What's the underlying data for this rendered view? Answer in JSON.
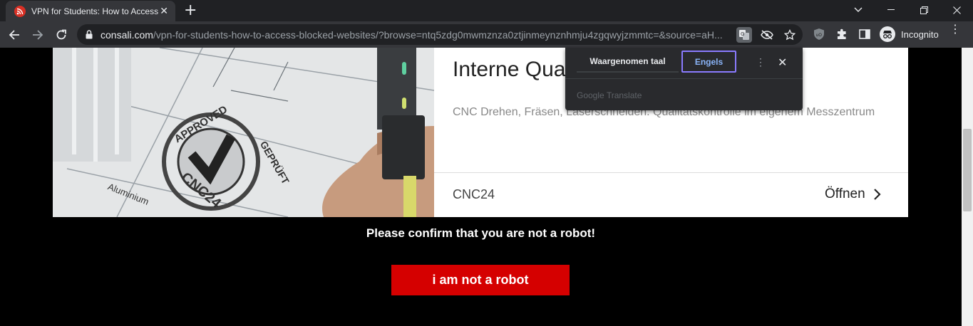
{
  "browser": {
    "tab_title": "VPN for Students: How to Access Blocked Websites",
    "tab_close": "✕",
    "new_tab": "+",
    "url_host": "consali.com",
    "url_path": "/vpn-for-students-how-to-access-blocked-websites/?browse=ntq5zdg0mwmznza0ztjinmeynznhmju4zgqwyjzmmtc=&source=aH...",
    "profile_label": "Incognito"
  },
  "translate_popup": {
    "detected_language": "Waargenomen taal",
    "target_language": "Engels",
    "brand_google": "Google",
    "brand_translate": "Translate"
  },
  "card": {
    "title": "Interne Qualitätskontrolle",
    "description": "CNC Drehen, Fräsen, Laserschneiden. Qualitätskontrolle im eigenem Messzentrum",
    "company": "CNC24",
    "open_label": "Öffnen",
    "stamp_top": "APPROVED",
    "stamp_right": "GEPRÜFT",
    "stamp_bottom": "CNC24",
    "drawing_label": "Aluminium"
  },
  "page": {
    "robot_prompt": "Please confirm that you are not a robot!",
    "robot_button": "i am not a robot"
  },
  "colors": {
    "robot_button": "#d50000",
    "translate_highlight": "#8a7bff"
  }
}
